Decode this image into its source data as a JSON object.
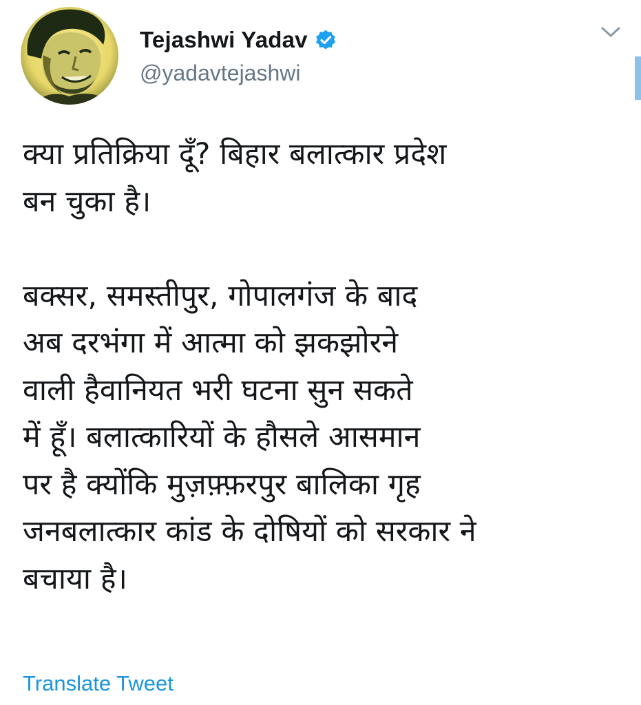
{
  "author": {
    "display_name": "Tejashwi Yadav",
    "handle": "@yadavtejashwi",
    "verified": true,
    "avatar_icon": "profile-photo"
  },
  "tweet": {
    "paragraphs": [
      [
        "क्या प्रतिक्रिया दूँ? बिहार बलात्कार प्रदेश",
        "बन चुका है।"
      ],
      [
        "बक्सर, समस्तीपुर, गोपालगंज के बाद",
        "अब दरभंगा में आत्मा को झकझोरने",
        "वाली हैवानियत भरी घटना सुन सकते",
        "में हूँ। बलात्कारियों के हौसले आसमान",
        "पर है क्योंकि मुज़फ़्फ़रपुर बालिका गृह",
        "जनबलात्कार कांड के दोषियों को सरकार ने",
        "बचाया है।"
      ]
    ]
  },
  "actions": {
    "translate_label": "Translate Tweet",
    "menu_icon": "chevron-down-icon"
  },
  "colors": {
    "text": "#14171a",
    "muted": "#657786",
    "link": "#1b95e0",
    "verified_badge": "#1da1f2",
    "avatar_tint": "#f2e27a"
  }
}
